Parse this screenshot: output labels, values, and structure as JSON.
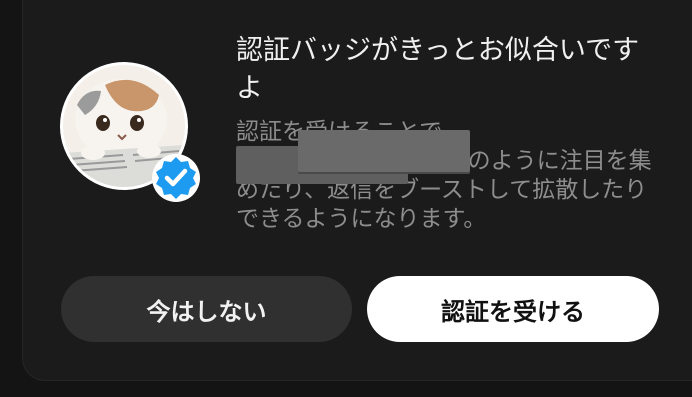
{
  "dialog": {
    "title": "認証バッジがきっとお似合いです よ",
    "body": "認証を受けることで、◯◯◯◯◯◯◯◯◯のように注目を集めたり、返信をブーストして拡散したりできるようになります。",
    "buttons": {
      "dismiss_label": "今はしない",
      "primary_label": "認証を受ける"
    }
  },
  "colors": {
    "background": "#141414",
    "card": "#1b1b1b",
    "verified_badge": "#1d9bf0",
    "primary_button": "#ffffff",
    "secondary_button": "#303030"
  },
  "icons": {
    "avatar": "user-avatar-cat",
    "badge": "verified-check-icon"
  }
}
